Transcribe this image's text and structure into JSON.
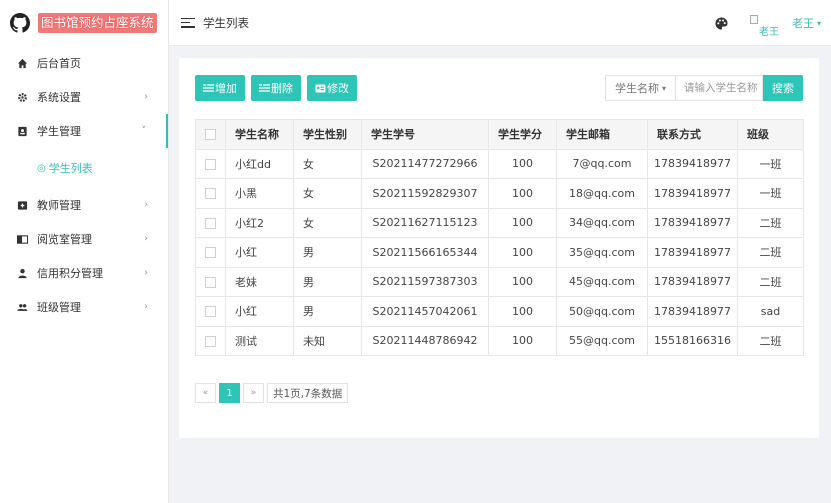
{
  "brand": {
    "title": "图书馆预约占座系统"
  },
  "sidebar": {
    "items": [
      {
        "label": "后台首页",
        "icon": "home-icon"
      },
      {
        "label": "系统设置",
        "icon": "gear-icon",
        "caret": "›"
      },
      {
        "label": "学生管理",
        "icon": "id-badge-icon",
        "caret": "˅"
      },
      {
        "label": "教师管理",
        "icon": "teacher-icon",
        "caret": "›"
      },
      {
        "label": "阅览室管理",
        "icon": "book-icon",
        "caret": "›"
      },
      {
        "label": "信用积分管理",
        "icon": "person-icon",
        "caret": "›"
      },
      {
        "label": "班级管理",
        "icon": "group-icon",
        "caret": "›"
      }
    ],
    "submenu": {
      "label": "学生列表",
      "bullet": "◎"
    }
  },
  "header": {
    "title": "学生列表",
    "avatar_alt": "老王",
    "user_name": "老王",
    "user_caret": "▾"
  },
  "toolbar": {
    "add_label": "增加",
    "delete_label": "删除",
    "edit_label": "修改"
  },
  "search": {
    "select_value": "学生名称",
    "select_caret": "▾",
    "placeholder": "请输入学生名称",
    "button_label": "搜索"
  },
  "table": {
    "headers": [
      "学生名称",
      "学生性别",
      "学生学号",
      "学生学分",
      "学生邮箱",
      "联系方式",
      "班级"
    ],
    "rows": [
      [
        "小红dd",
        "女",
        "S20211477272966",
        "100",
        "7@qq.com",
        "17839418977",
        "一班"
      ],
      [
        "小黑",
        "女",
        "S20211592829307",
        "100",
        "18@qq.com",
        "17839418977",
        "一班"
      ],
      [
        "小红2",
        "女",
        "S20211627115123",
        "100",
        "34@qq.com",
        "17839418977",
        "二班"
      ],
      [
        "小红",
        "男",
        "S20211566165344",
        "100",
        "35@qq.com",
        "17839418977",
        "二班"
      ],
      [
        "老妹",
        "男",
        "S20211597387303",
        "100",
        "45@qq.com",
        "17839418977",
        "二班"
      ],
      [
        "小红",
        "男",
        "S20211457042061",
        "100",
        "50@qq.com",
        "17839418977",
        "sad"
      ],
      [
        "测试",
        "未知",
        "S20211448786942",
        "100",
        "55@qq.com",
        "15518166316",
        "二班"
      ]
    ]
  },
  "pagination": {
    "prev": "«",
    "current": "1",
    "next": "»",
    "info": "共1页,7条数据"
  },
  "colors": {
    "accent": "#2ec4b6",
    "brand_bg": "#f07a7a"
  }
}
